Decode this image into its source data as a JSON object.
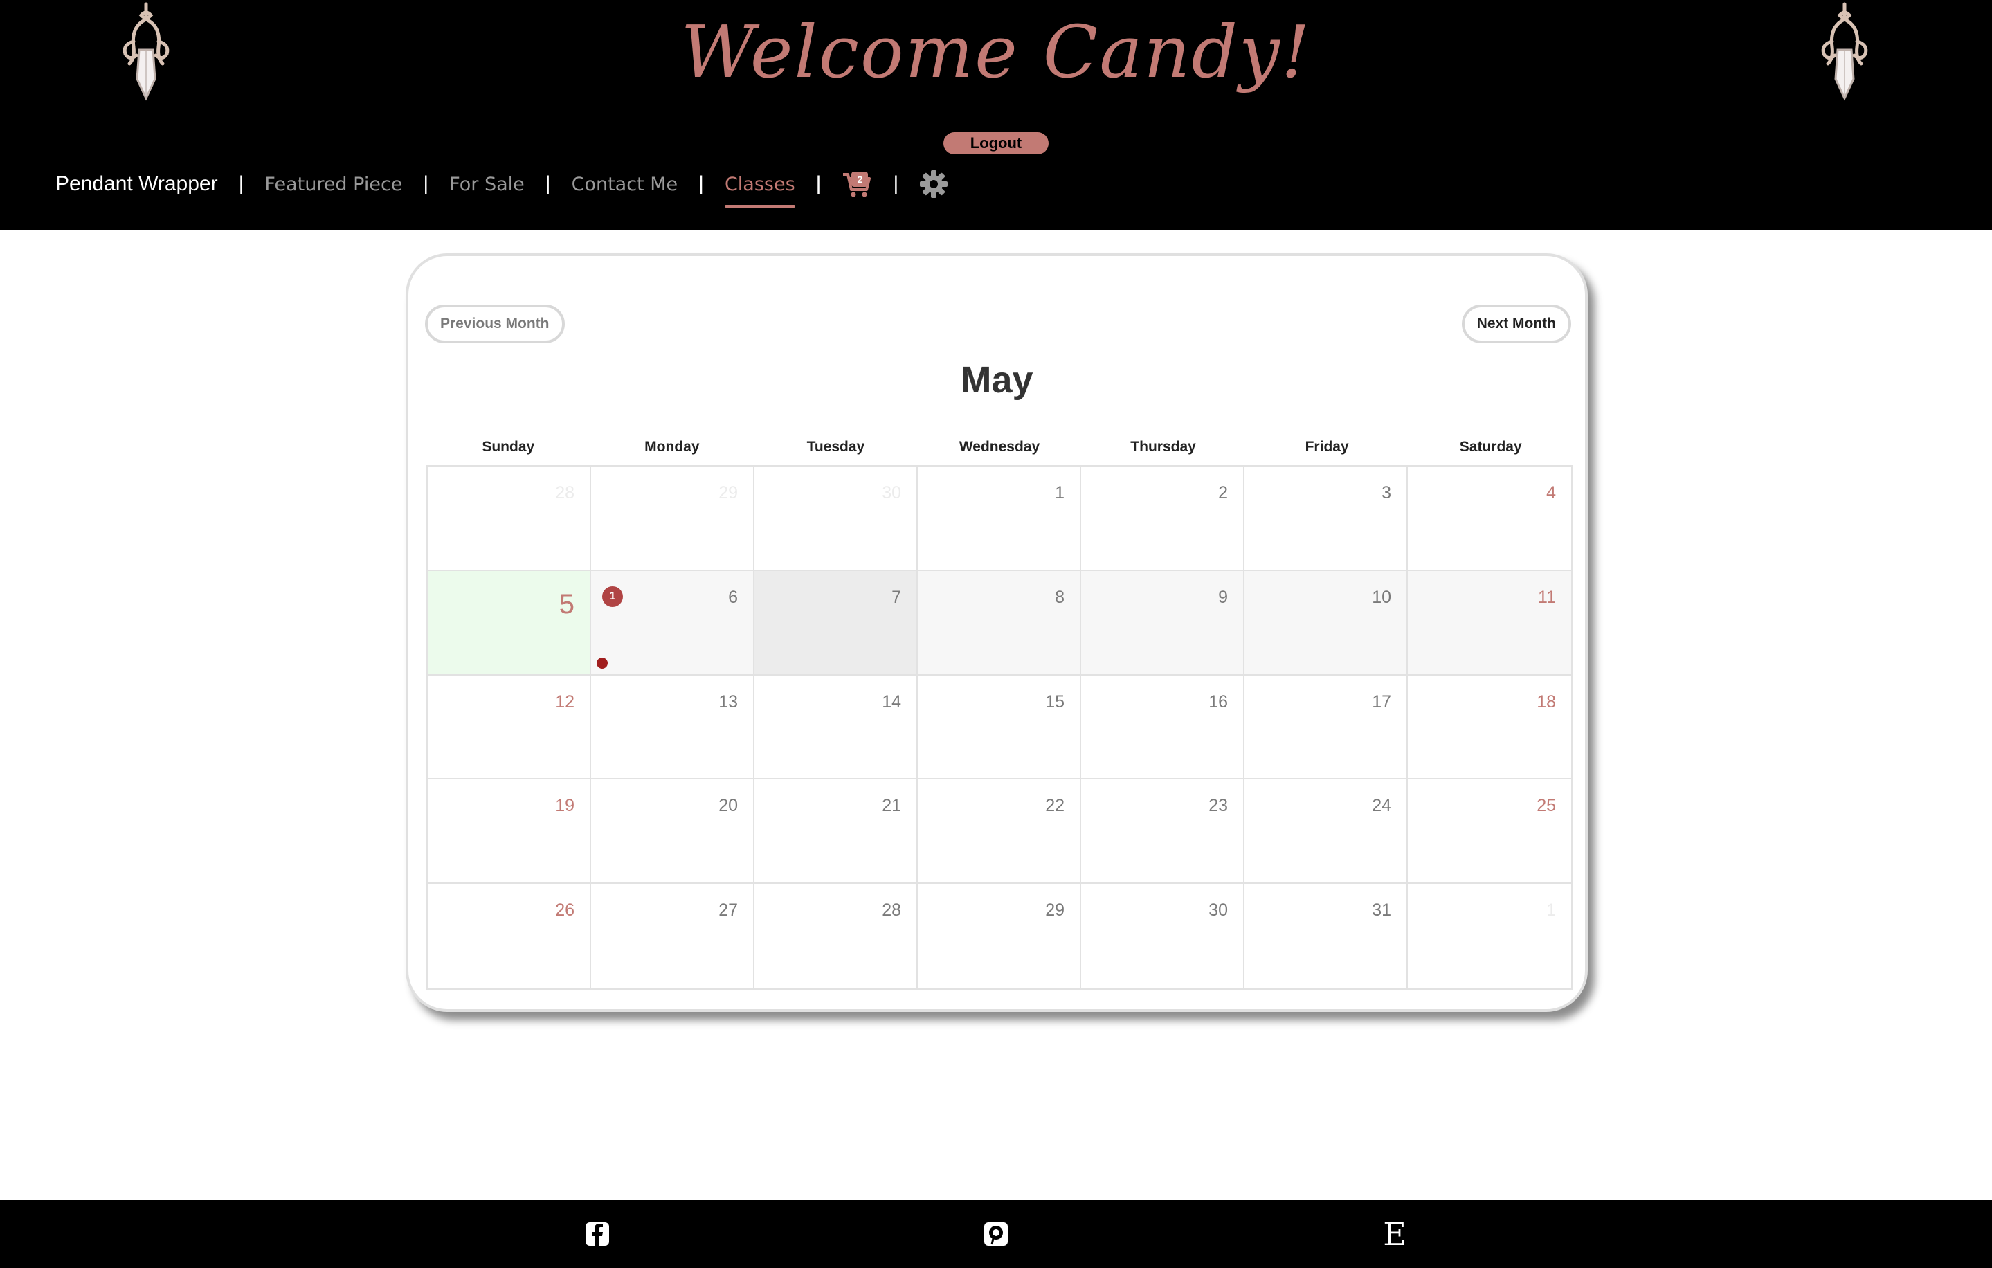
{
  "header": {
    "welcome_text": "Welcome Candy!",
    "logout_label": "Logout"
  },
  "nav": {
    "brand": "Pendant Wrapper",
    "links": [
      {
        "label": "Featured Piece",
        "active": false
      },
      {
        "label": "For Sale",
        "active": false
      },
      {
        "label": "Contact Me",
        "active": false
      },
      {
        "label": "Classes",
        "active": true
      }
    ],
    "separator": "|",
    "cart_count": "2"
  },
  "calendar": {
    "prev_label": "Previous Month",
    "next_label": "Next Month",
    "month": "May",
    "weekdays": [
      "Sunday",
      "Monday",
      "Tuesday",
      "Wednesday",
      "Thursday",
      "Friday",
      "Saturday"
    ],
    "days": [
      {
        "n": "28",
        "other": true
      },
      {
        "n": "29",
        "other": true
      },
      {
        "n": "30",
        "other": true
      },
      {
        "n": "1"
      },
      {
        "n": "2"
      },
      {
        "n": "3"
      },
      {
        "n": "4"
      },
      {
        "n": "5",
        "today": true
      },
      {
        "n": "6",
        "events": "1",
        "dot": true
      },
      {
        "n": "7",
        "selected": true
      },
      {
        "n": "8"
      },
      {
        "n": "9"
      },
      {
        "n": "10"
      },
      {
        "n": "11"
      },
      {
        "n": "12"
      },
      {
        "n": "13"
      },
      {
        "n": "14"
      },
      {
        "n": "15"
      },
      {
        "n": "16"
      },
      {
        "n": "17"
      },
      {
        "n": "18"
      },
      {
        "n": "19"
      },
      {
        "n": "20"
      },
      {
        "n": "21"
      },
      {
        "n": "22"
      },
      {
        "n": "23"
      },
      {
        "n": "24"
      },
      {
        "n": "25"
      },
      {
        "n": "26"
      },
      {
        "n": "27"
      },
      {
        "n": "28"
      },
      {
        "n": "29"
      },
      {
        "n": "30"
      },
      {
        "n": "31"
      },
      {
        "n": "1",
        "other": true
      }
    ]
  },
  "footer": {
    "icons": [
      "facebook-icon",
      "pinterest-icon",
      "etsy-icon"
    ],
    "etsy_glyph": "E"
  },
  "colors": {
    "accent": "#c27a74",
    "today_bg": "#ecfbec",
    "selected_bg": "#ececec",
    "event_badge": "#b04444"
  }
}
